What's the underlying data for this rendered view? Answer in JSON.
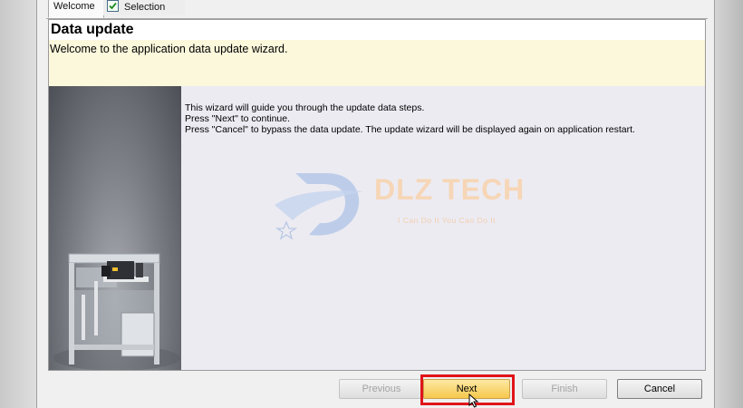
{
  "tabs": [
    {
      "label": "Welcome"
    },
    {
      "label": "Selection"
    }
  ],
  "header": {
    "title": "Data update",
    "subtitle": "Welcome to the application data update wizard."
  },
  "content": {
    "lines": [
      "This wizard will guide you through the update data steps.",
      "Press \"Next\" to continue.",
      "Press \"Cancel\" to bypass the data update. The update wizard will be displayed again on application restart."
    ]
  },
  "watermark": {
    "title": "DLZ TECH",
    "slogan": "I Can Do It You Can Do It"
  },
  "buttons": {
    "previous": "Previous",
    "next": "Next",
    "finish": "Finish",
    "cancel": "Cancel"
  },
  "colors": {
    "header_background": "#fcf8dc",
    "next_button": "#f6c84c",
    "highlight_border": "#e0141a"
  }
}
